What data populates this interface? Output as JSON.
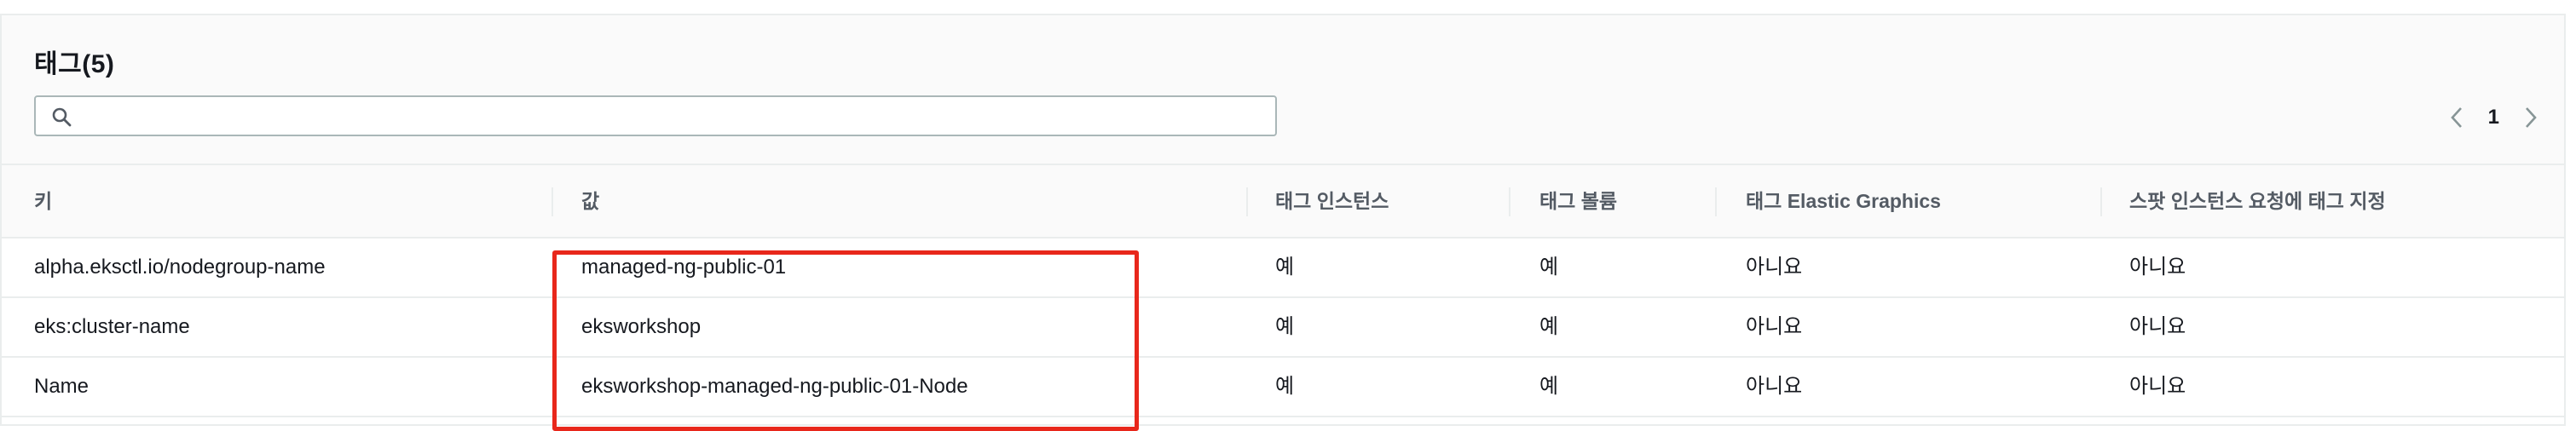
{
  "panel": {
    "title": "태그(5)",
    "search": {
      "value": "",
      "placeholder": ""
    },
    "pagination": {
      "current_page": "1"
    }
  },
  "table": {
    "columns": [
      "키",
      "값",
      "태그 인스턴스",
      "태그 볼륨",
      "태그 Elastic Graphics",
      "스팟 인스턴스 요청에 태그 지정"
    ],
    "rows": [
      [
        "alpha.eksctl.io/nodegroup-name",
        "managed-ng-public-01",
        "예",
        "예",
        "아니요",
        "아니요"
      ],
      [
        "eks:cluster-name",
        "eksworkshop",
        "예",
        "예",
        "아니요",
        "아니요"
      ],
      [
        "Name",
        "eksworkshop-managed-ng-public-01-Node",
        "예",
        "예",
        "아니요",
        "아니요"
      ]
    ]
  },
  "icons": {
    "search": "search-icon",
    "prev": "chevron-left-icon",
    "next": "chevron-right-icon"
  },
  "colors": {
    "highlight_border": "#e8271b",
    "header_bg": "#fafafa",
    "border": "#eaeded"
  }
}
